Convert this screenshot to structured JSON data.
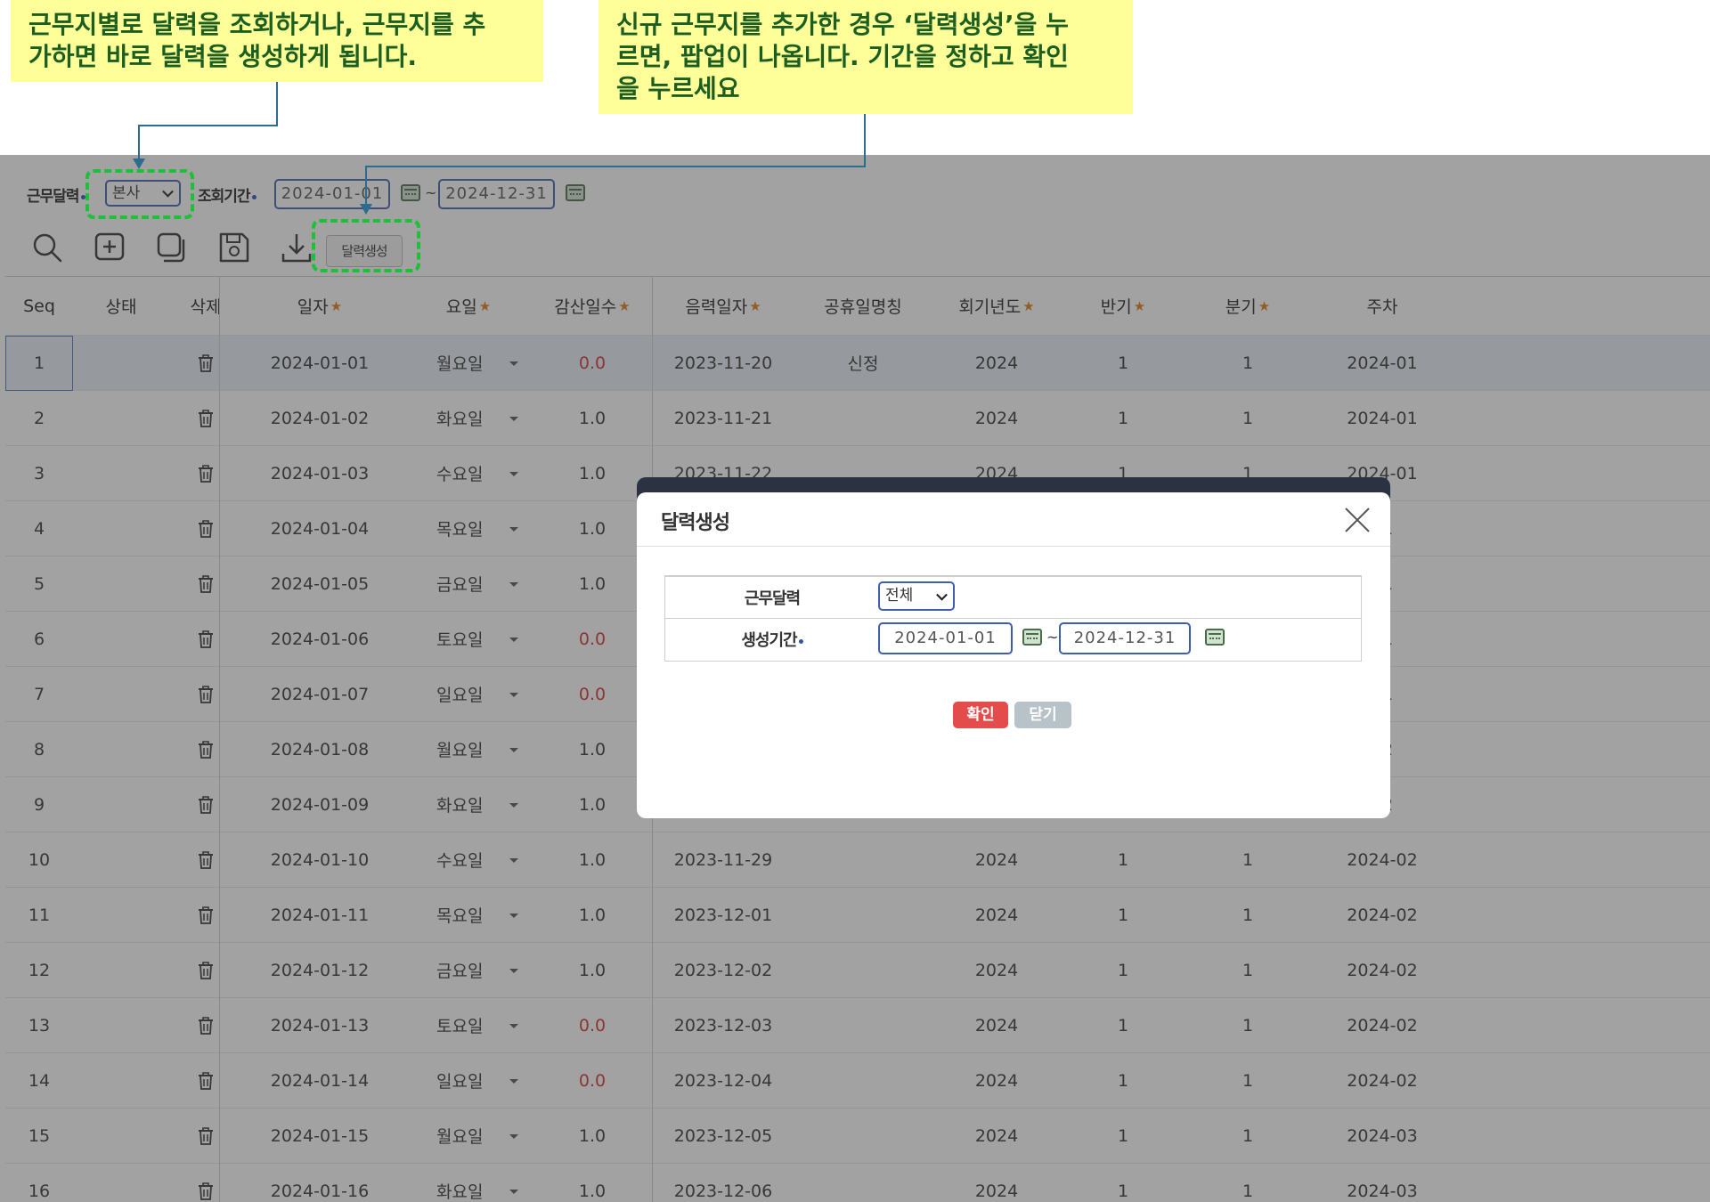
{
  "callouts": {
    "left": "근무지별로 달력을 조회하거나, 근무지를 추\n가하면 바로 달력을 생성하게 됩니다.",
    "right": "신규 근무지를 추가한 경우 ‘달력생성’을 누\n르면, 팝업이 나옵니다. 기간을 정하고 확인\n을 누르세요"
  },
  "filters": {
    "calendar_label": "근무달력",
    "calendar_value": "본사",
    "period_label": "조회기간",
    "date_from": "2024-01-01",
    "tilde": "~",
    "date_to": "2024-12-31"
  },
  "toolbar": {
    "generate_button": "달력생성",
    "icons": [
      "search-icon",
      "add-icon",
      "copy-icon",
      "save-icon",
      "download-icon"
    ]
  },
  "grid": {
    "columns": [
      "Seq",
      "상태",
      "삭제",
      "일자",
      "요일",
      "감산일수",
      "음력일자",
      "공휴일명칭",
      "회기년도",
      "반기",
      "분기",
      "주차"
    ],
    "required_columns": [
      "일자",
      "요일",
      "감산일수",
      "음력일자",
      "회기년도",
      "반기",
      "분기"
    ],
    "rows": [
      {
        "seq": "1",
        "date": "2024-01-01",
        "weekday": "월요일",
        "deduct": "0.0",
        "lunar": "2023-11-20",
        "holiday": "신정",
        "year": "2024",
        "half": "1",
        "quarter": "1",
        "week": "2024-01"
      },
      {
        "seq": "2",
        "date": "2024-01-02",
        "weekday": "화요일",
        "deduct": "1.0",
        "lunar": "2023-11-21",
        "holiday": "",
        "year": "2024",
        "half": "1",
        "quarter": "1",
        "week": "2024-01"
      },
      {
        "seq": "3",
        "date": "2024-01-03",
        "weekday": "수요일",
        "deduct": "1.0",
        "lunar": "2023-11-22",
        "holiday": "",
        "year": "2024",
        "half": "1",
        "quarter": "1",
        "week": "2024-01"
      },
      {
        "seq": "4",
        "date": "2024-01-04",
        "weekday": "목요일",
        "deduct": "1.0",
        "lunar": "",
        "holiday": "",
        "year": "",
        "half": "",
        "quarter": "",
        "week": "01"
      },
      {
        "seq": "5",
        "date": "2024-01-05",
        "weekday": "금요일",
        "deduct": "1.0",
        "lunar": "",
        "holiday": "",
        "year": "",
        "half": "",
        "quarter": "",
        "week": "01"
      },
      {
        "seq": "6",
        "date": "2024-01-06",
        "weekday": "토요일",
        "deduct": "0.0",
        "lunar": "",
        "holiday": "",
        "year": "",
        "half": "",
        "quarter": "",
        "week": "01"
      },
      {
        "seq": "7",
        "date": "2024-01-07",
        "weekday": "일요일",
        "deduct": "0.0",
        "lunar": "",
        "holiday": "",
        "year": "",
        "half": "",
        "quarter": "",
        "week": "01"
      },
      {
        "seq": "8",
        "date": "2024-01-08",
        "weekday": "월요일",
        "deduct": "1.0",
        "lunar": "",
        "holiday": "",
        "year": "",
        "half": "",
        "quarter": "",
        "week": "02"
      },
      {
        "seq": "9",
        "date": "2024-01-09",
        "weekday": "화요일",
        "deduct": "1.0",
        "lunar": "",
        "holiday": "",
        "year": "",
        "half": "",
        "quarter": "",
        "week": "02"
      },
      {
        "seq": "10",
        "date": "2024-01-10",
        "weekday": "수요일",
        "deduct": "1.0",
        "lunar": "2023-11-29",
        "holiday": "",
        "year": "2024",
        "half": "1",
        "quarter": "1",
        "week": "2024-02"
      },
      {
        "seq": "11",
        "date": "2024-01-11",
        "weekday": "목요일",
        "deduct": "1.0",
        "lunar": "2023-12-01",
        "holiday": "",
        "year": "2024",
        "half": "1",
        "quarter": "1",
        "week": "2024-02"
      },
      {
        "seq": "12",
        "date": "2024-01-12",
        "weekday": "금요일",
        "deduct": "1.0",
        "lunar": "2023-12-02",
        "holiday": "",
        "year": "2024",
        "half": "1",
        "quarter": "1",
        "week": "2024-02"
      },
      {
        "seq": "13",
        "date": "2024-01-13",
        "weekday": "토요일",
        "deduct": "0.0",
        "lunar": "2023-12-03",
        "holiday": "",
        "year": "2024",
        "half": "1",
        "quarter": "1",
        "week": "2024-02"
      },
      {
        "seq": "14",
        "date": "2024-01-14",
        "weekday": "일요일",
        "deduct": "0.0",
        "lunar": "2023-12-04",
        "holiday": "",
        "year": "2024",
        "half": "1",
        "quarter": "1",
        "week": "2024-02"
      },
      {
        "seq": "15",
        "date": "2024-01-15",
        "weekday": "월요일",
        "deduct": "1.0",
        "lunar": "2023-12-05",
        "holiday": "",
        "year": "2024",
        "half": "1",
        "quarter": "1",
        "week": "2024-03"
      },
      {
        "seq": "16",
        "date": "2024-01-16",
        "weekday": "화요일",
        "deduct": "1.0",
        "lunar": "2023-12-06",
        "holiday": "",
        "year": "2024",
        "half": "1",
        "quarter": "1",
        "week": "2024-03"
      }
    ]
  },
  "modal": {
    "title": "달력생성",
    "calendar_label": "근무달력",
    "calendar_value": "전체",
    "period_label": "생성기간",
    "date_from": "2024-01-01",
    "tilde": "~",
    "date_to": "2024-12-31",
    "confirm": "확인",
    "close": "닫기"
  },
  "colors": {
    "callout_bg": "#ffff99",
    "callout_text": "#1b5e20",
    "highlight_dash": "#1fbf3a",
    "zero_value": "#d32f2f",
    "confirm_button": "#e44b4b",
    "close_button": "#b8c2c9",
    "required_star": "#e07a10"
  }
}
